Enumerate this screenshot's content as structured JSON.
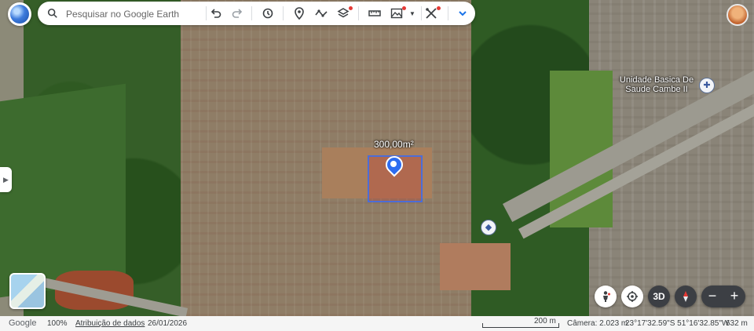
{
  "search": {
    "placeholder": "Pesquisar no Google Earth"
  },
  "toolbar": {
    "items": [
      {
        "name": "undo",
        "icon": "undo-icon"
      },
      {
        "name": "redo",
        "icon": "redo-icon"
      },
      {
        "name": "history",
        "icon": "history-icon"
      },
      {
        "name": "add-placemark",
        "icon": "placemark-icon"
      },
      {
        "name": "add-path",
        "icon": "path-icon"
      },
      {
        "name": "layers",
        "icon": "layers-icon"
      },
      {
        "name": "measure",
        "icon": "ruler-icon"
      },
      {
        "name": "map-style",
        "icon": "mountain-icon"
      },
      {
        "name": "tools",
        "icon": "tools-icon"
      },
      {
        "name": "expand",
        "icon": "chevron-down-icon"
      }
    ],
    "accent": "#1a73e8",
    "notification_dot": "#e53935"
  },
  "map": {
    "measurement_label": "300,00m²",
    "poi": {
      "label_line1": "Unidade Basica De",
      "label_line2": "Saude Cambe II",
      "icon": "hospital-icon"
    },
    "poi_small": {
      "icon": "building-icon"
    },
    "highlight_color": "#426ee6"
  },
  "controls": {
    "pegman": "pegman-icon",
    "orbit": "orbit-icon",
    "mode_3d": "3D",
    "compass": "compass-icon",
    "zoom_out": "−",
    "zoom_in": "+"
  },
  "status": {
    "brand": "Google",
    "zoom": "100%",
    "attribution": "Atribuição de dados",
    "date": "26/01/2026",
    "scale": "200 m",
    "camera": "Câmera: 2.023 m",
    "coordinates": "23°17'32.59\"S 51°16'32.85\"W",
    "elevation": "632 m"
  }
}
